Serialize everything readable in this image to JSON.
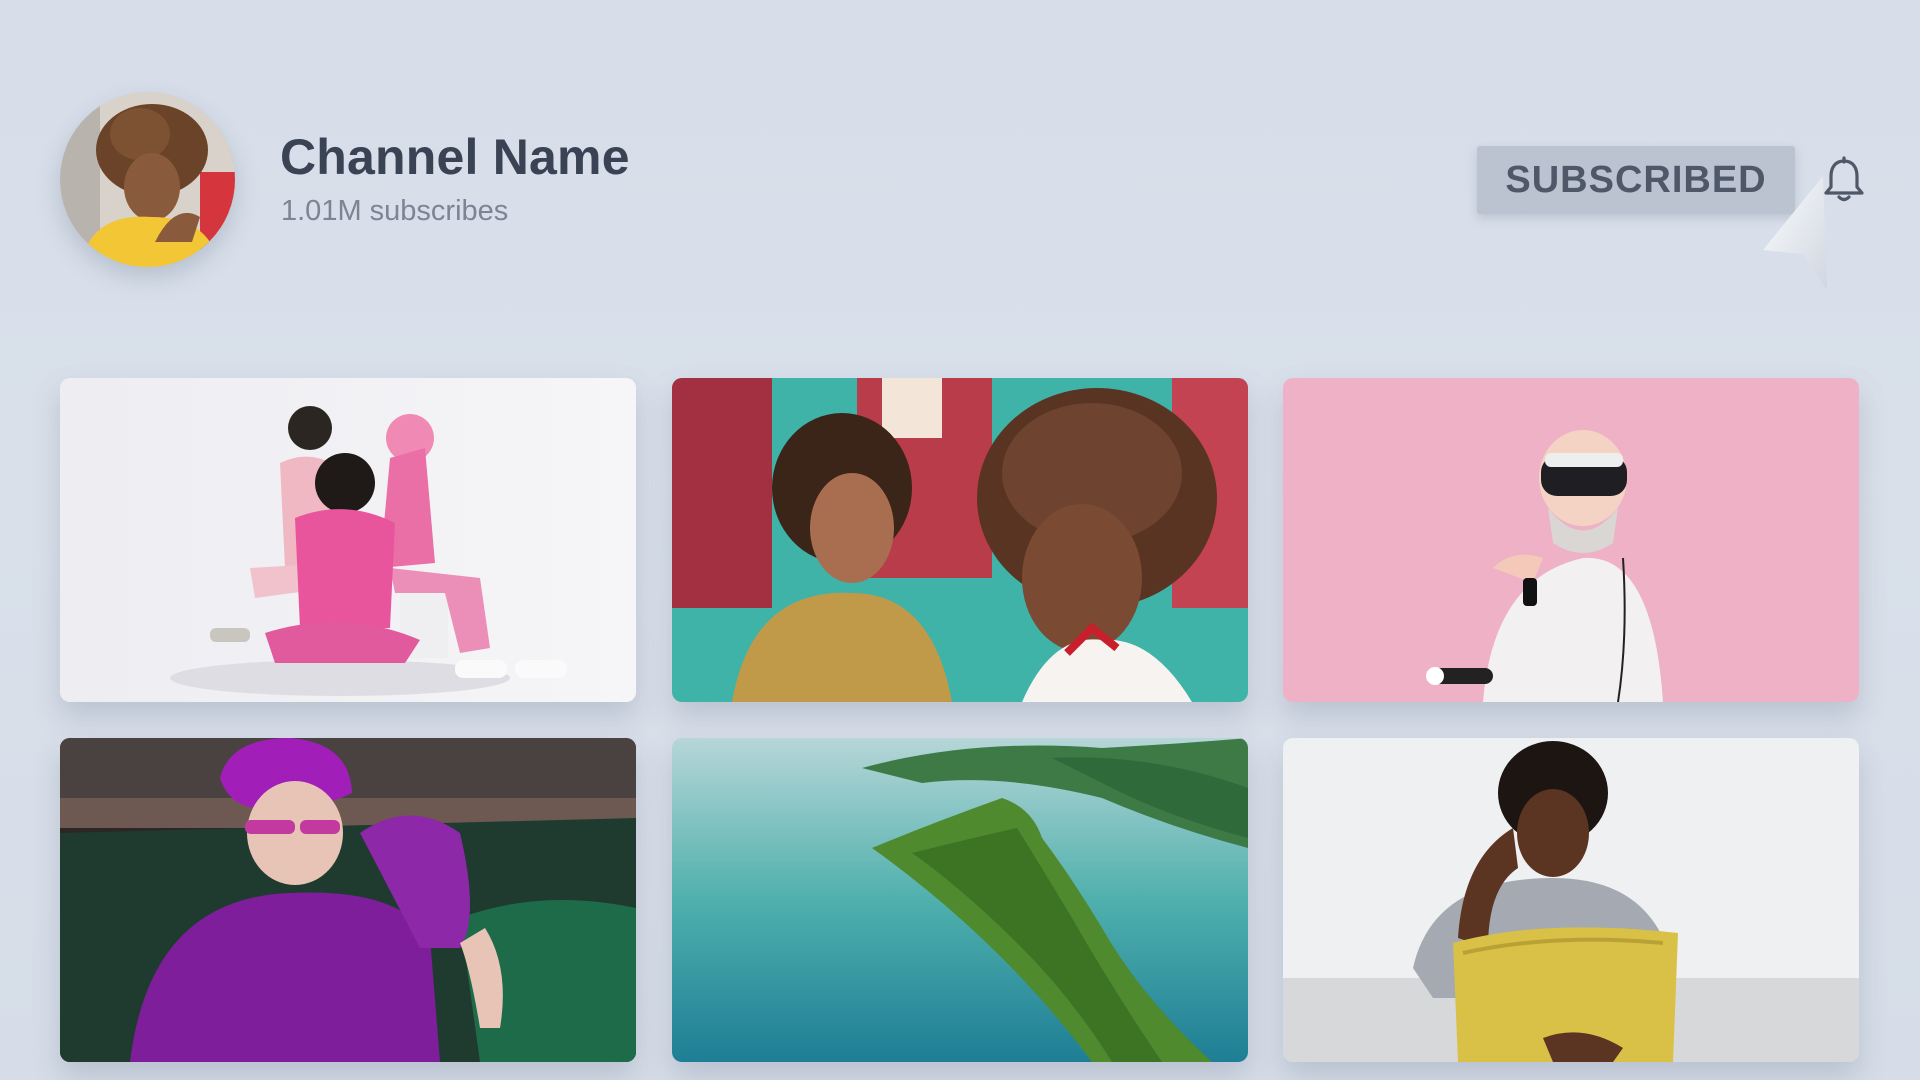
{
  "channel": {
    "name": "Channel Name",
    "subscribers": "1.01M subscribes"
  },
  "actions": {
    "subscribe_label": "SUBSCRIBED",
    "bell_icon": "bell-icon"
  },
  "videos": [
    {
      "subject": "three people in pink outfits sitting"
    },
    {
      "subject": "two women with curly hair"
    },
    {
      "subject": "man wearing vr headset on pink background"
    },
    {
      "subject": "person with purple hair and sweater"
    },
    {
      "subject": "aerial view of green island in turquoise sea"
    },
    {
      "subject": "woman with yellow chair"
    }
  ],
  "colors": {
    "background": "#d8dfe9",
    "title": "#3a4354",
    "subtitle": "#7c8596",
    "button_bg": "#bac3cf",
    "button_text": "#4f5868"
  }
}
